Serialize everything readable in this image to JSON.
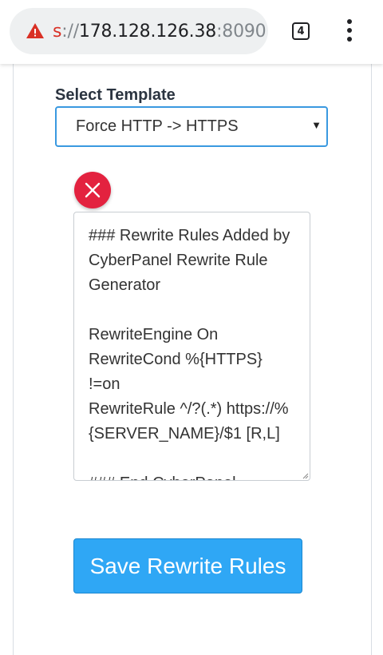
{
  "browser": {
    "url": {
      "scheme": "s",
      "separator": "://",
      "host": "178.128.126.38",
      "port": ":8090"
    },
    "tab_count": "4",
    "security_icon": "warning-triangle-icon",
    "accent_warning": "#d93025"
  },
  "form": {
    "template_label": "Select Template",
    "template_selected": "Force HTTP -> HTTPS",
    "close_icon": "close-icon",
    "rules_lines": [
      "### Rewrite Rules Added by",
      "CyberPanel Rewrite Rule",
      "Generator",
      "",
      "RewriteEngine On",
      "RewriteCond %{HTTPS}",
      "!=on",
      "RewriteRule ^/?(.*) https://%",
      "{SERVER_NAME}/$1 [R,L]",
      "",
      "### End CyberPanel"
    ],
    "save_label": "Save Rewrite Rules",
    "colors": {
      "primary": "#2fa7f5",
      "danger": "#e3223f",
      "focus_border": "#3a99e0"
    }
  }
}
